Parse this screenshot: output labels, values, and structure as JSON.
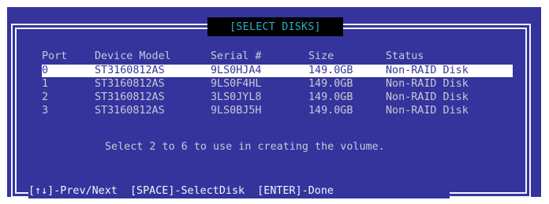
{
  "title": "[SELECT DISKS]",
  "columns": {
    "port": "Port",
    "model": "Device Model",
    "serial": "Serial #",
    "size": "Size",
    "status": "Status"
  },
  "rows": [
    {
      "port": "0",
      "model": "ST3160812AS",
      "serial": "9LS0HJA4",
      "size": "149.0GB",
      "status": "Non-RAID Disk"
    },
    {
      "port": "1",
      "model": "ST3160812AS",
      "serial": "9LS0F4HL",
      "size": "149.0GB",
      "status": "Non-RAID Disk"
    },
    {
      "port": "2",
      "model": "ST3160812AS",
      "serial": "3LS0JYL8",
      "size": "149.0GB",
      "status": "Non-RAID Disk"
    },
    {
      "port": "3",
      "model": "ST3160812AS",
      "serial": "9LS0BJ5H",
      "size": "149.0GB",
      "status": "Non-RAID Disk"
    }
  ],
  "selected_row": 0,
  "hint": "Select 2 to 6 to use in creating the volume.",
  "help": "[↑↓]-Prev/Next  [SPACE]-SelectDisk  [ENTER]-Done",
  "colors": {
    "background": "#34349c",
    "title_text": "#2ab0c8",
    "title_bg": "#000000",
    "text": "#c8c8d8",
    "highlight_bg": "#ffffff"
  }
}
